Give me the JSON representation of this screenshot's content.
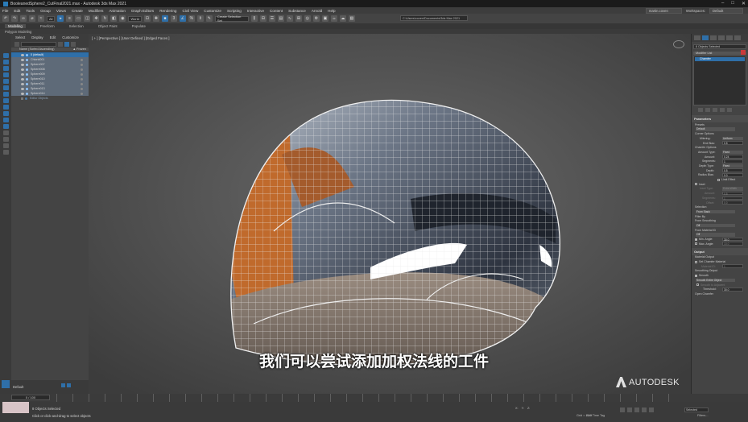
{
  "window": {
    "title": "BooleanedSphere2_CutFinal2021.max - Autodesk 3ds Max 2021",
    "controls": [
      "–",
      "□",
      "✕"
    ]
  },
  "menu": [
    "File",
    "Edit",
    "Tools",
    "Group",
    "Views",
    "Create",
    "Modifiers",
    "Animation",
    "Graph Editors",
    "Rendering",
    "Civil View",
    "Customize",
    "Scripting",
    "Interactive",
    "Content",
    "Substance",
    "Arnold",
    "Help"
  ],
  "user": {
    "name": "martin.coven",
    "workspace_label": "Workspaces:",
    "workspace": "Default"
  },
  "toolbar": {
    "selection_filter": "All",
    "ref_coord": "World",
    "named_selection": "Create Selection Set",
    "project_path": "C:\\Users\\coven\\Documents\\3ds Max 2021"
  },
  "ribbon": {
    "tabs": [
      "Modeling",
      "Freeform",
      "Selection",
      "Object Paint",
      "Populate"
    ],
    "active": "Modeling",
    "sub": "Polygon Modeling"
  },
  "scene_explorer": {
    "menu": [
      "Select",
      "Display",
      "Edit",
      "Customize"
    ],
    "header_name": "Name (Sorted Ascending)",
    "header_frozen": "▲ Frozen",
    "rows": [
      {
        "label": "0 (default)",
        "type": "root"
      },
      {
        "label": "Chlorid001",
        "type": "sel"
      },
      {
        "label": "Sphere007",
        "type": "sel"
      },
      {
        "label": "Sphere008",
        "type": "sel"
      },
      {
        "label": "Sphere009",
        "type": "sel"
      },
      {
        "label": "Sphere010",
        "type": "sel"
      },
      {
        "label": "Sphere011",
        "type": "sel"
      },
      {
        "label": "Sphere013",
        "type": "sel"
      },
      {
        "label": "Sphere014",
        "type": "sel"
      },
      {
        "label": "Editor Objects",
        "type": "dim"
      }
    ]
  },
  "viewport": {
    "label": "[ + ] [Perspective ] [User Defined ] [Edged Faces ]"
  },
  "subtitle": "我们可以尝试添加加权法线的工件",
  "brand": "AUTODESK",
  "command_panel": {
    "object_name": "8 Objects Selected",
    "modifier_list_label": "Modifier List",
    "stack_item": "Chamfer",
    "sections": {
      "parameters": "Parameters",
      "presets_label": "Presets",
      "preset_value": "Default",
      "corner_options": "Corner Options",
      "mitering": {
        "label": "Mitering:",
        "value": "Uniform"
      },
      "end_bias": {
        "label": "End Bias:",
        "value": "0.5"
      },
      "chamfer_options": "Chamfer Options",
      "amount_type": {
        "label": "Amount Type:",
        "value": "Fixed"
      },
      "amount": {
        "label": "Amount:",
        "value": "0.24"
      },
      "segments": {
        "label": "Segments:",
        "value": "1"
      },
      "depth_type": {
        "label": "Depth Type:",
        "value": "Fixed"
      },
      "depth": {
        "label": "Depth:",
        "value": "0.5"
      },
      "radius_bias": {
        "label": "Radius Bias:",
        "value": "0.0"
      },
      "limit_effect": "Limit Effect",
      "inset": "Inset",
      "inset_type": {
        "label": "Inset Type:",
        "value": "Extra Width"
      },
      "inset_amount": {
        "label": "Amount:",
        "value": "0.5"
      },
      "inset_segments": {
        "label": "Segments:",
        "value": "1"
      },
      "inset_offset": {
        "label": "Offset:",
        "value": "0.0"
      },
      "selection": "Selection",
      "selection_value": "From Stack",
      "filter_by": "Filter By",
      "from_smoothing": "From Smoothing",
      "smoothing_value": "Off",
      "from_material": "From Material ID",
      "material_value": "Off",
      "min_angle": {
        "label": "Min. Angle:",
        "value": "30.0"
      },
      "max_angle": {
        "label": "Max. Angle:",
        "value": "10.0"
      },
      "output": "Output",
      "material_output": "Material Output",
      "set_chamfer_material": "Set Chamfer Material",
      "material_id": {
        "label": "Material ID:",
        "value": "1"
      },
      "smoothing_output": "Smoothing Output",
      "smooth": "Smooth",
      "smooth_value": "Smooth Entire Object",
      "smooth_to_adjacent": "Smooth to Adjacent",
      "threshold": {
        "label": "Threshold:",
        "value": "30.0"
      },
      "open_chamfer": "Open Chamfer"
    }
  },
  "bottom": {
    "layer": "Default",
    "frame": "0 / 100",
    "status": "8 Objects Selected",
    "prompt": "Click or click-and-drag to select objects",
    "coords": [
      "X:",
      "Y:",
      "Z:"
    ],
    "grid": "Grid = 10.0",
    "add_time_tag": "Add Time Tag",
    "key_filter": "Selected",
    "filters": "Filters..."
  }
}
